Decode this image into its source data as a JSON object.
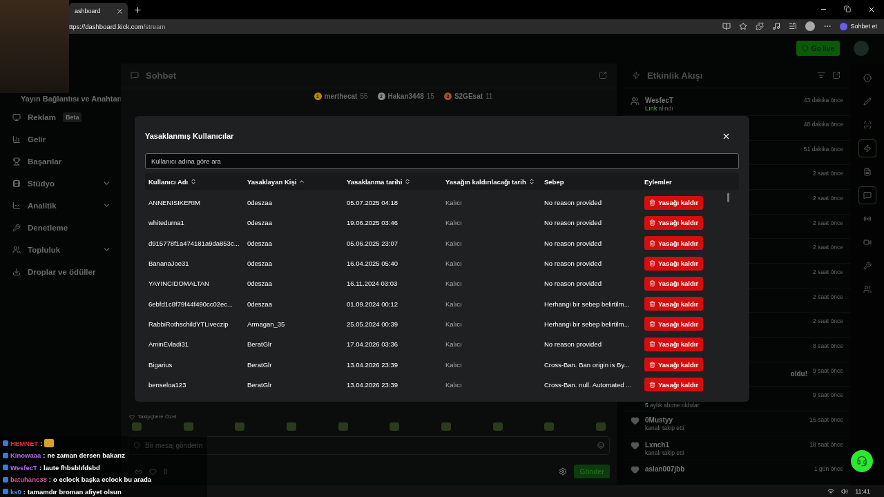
{
  "browser": {
    "tab_title": "ashboard",
    "url_host": "ttps://dashboard.kick.com",
    "url_path": "/stream",
    "copilot_label": "Sohbet et"
  },
  "header": {
    "go_live": "Go live"
  },
  "sidebar": {
    "items": [
      {
        "label": "Yayın Bağlantısı ve Anahtarı"
      },
      {
        "label": "Reklam",
        "badge": "Beta",
        "expandable": false
      },
      {
        "label": "Gelir",
        "expandable": false
      },
      {
        "label": "Başarılar",
        "expandable": false
      },
      {
        "label": "Stüdyo",
        "expandable": true
      },
      {
        "label": "Analitik",
        "expandable": true
      },
      {
        "label": "Denetleme",
        "expandable": false
      },
      {
        "label": "Topluluk",
        "expandable": true
      },
      {
        "label": "Droplar ve ödüller",
        "expandable": false
      }
    ]
  },
  "chat": {
    "title": "Sohbet",
    "leaderboard": [
      {
        "rank": "1",
        "name": "merthecat",
        "count": "55",
        "color": "#b8860b"
      },
      {
        "rank": "2",
        "name": "Hakan3448",
        "count": "15",
        "color": "#8a8a8a"
      },
      {
        "rank": "3",
        "name": "S2GEsat",
        "count": "11",
        "color": "#a0522d"
      }
    ],
    "followers_only_label": "Takipçilere Özel",
    "input_placeholder": "Bir mesaj gönderin",
    "points": "0",
    "send": "Gönder"
  },
  "activity": {
    "title": "Etkinlik Akışı",
    "items": [
      {
        "kind": "event",
        "user": "WesfecT",
        "highlight": "Link",
        "detail": "alındı",
        "time": "43 dakika önce"
      },
      {
        "kind": "plain",
        "time": "48 dakika önce"
      },
      {
        "kind": "plain",
        "time": "51 dakika önce"
      },
      {
        "kind": "plain",
        "time": "2 saat önce"
      },
      {
        "kind": "plain",
        "time": "2 saat önce"
      },
      {
        "kind": "plain",
        "time": "2 saat önce"
      },
      {
        "kind": "plain",
        "time": "2 saat önce"
      },
      {
        "kind": "plain",
        "time": "2 saat önce"
      },
      {
        "kind": "plain",
        "time": "2 saat önce"
      },
      {
        "kind": "plain",
        "time": "2 saat önce"
      },
      {
        "kind": "plain",
        "time": "8 saat önce"
      },
      {
        "kind": "plain",
        "user": "oldu!",
        "time": "9 saat önce"
      },
      {
        "kind": "plain",
        "highlight": "5",
        "detail": "aylık abone oldular",
        "time": "9 saat önce"
      },
      {
        "kind": "follow",
        "user": "0Mustyy",
        "detail": "kanalı takip etti",
        "time": "15 saat önce"
      },
      {
        "kind": "follow",
        "user": "Lxnch1",
        "detail": "kanalı takip etti",
        "time": "18 saat önce"
      },
      {
        "kind": "follow",
        "user": "aslan007jbb",
        "time": "1 gün önce"
      }
    ]
  },
  "rail": [
    {
      "selected": false
    },
    {
      "selected": false
    },
    {
      "selected": false
    },
    {
      "selected": true
    },
    {
      "selected": false
    },
    {
      "selected": true
    },
    {
      "selected": false
    },
    {
      "selected": false
    },
    {
      "selected": false
    },
    {
      "selected": false
    }
  ],
  "modal": {
    "title": "Yasaklanmış Kullanıcılar",
    "search_placeholder": "Kullanıcı adına göre ara",
    "columns": [
      {
        "label": "Kullanıcı Adı",
        "sortable": true,
        "sorted_ascending": false
      },
      {
        "label": "Yasaklayan Kişi",
        "sortable": true,
        "sorted_ascending": true
      },
      {
        "label": "Yasaklanma tarihi",
        "sortable": true,
        "sorted_ascending": false
      },
      {
        "label": "Yasağın kaldırılacağı tarih",
        "sortable": true,
        "sorted_ascending": false
      },
      {
        "label": "Sebep",
        "sortable": false
      },
      {
        "label": "Eylemler",
        "sortable": false
      }
    ],
    "rows": [
      {
        "user": "ANNENISIKERIM",
        "banned_by": "0deszaa",
        "banned_at": "05.07.2025 04:18",
        "expires": "Kalıcı",
        "reason": "No reason provided",
        "action": "Yasağı kaldır"
      },
      {
        "user": "whitedurna1",
        "banned_by": "0deszaa",
        "banned_at": "19.06.2025 03:46",
        "expires": "Kalıcı",
        "reason": "No reason provided",
        "action": "Yasağı kaldır"
      },
      {
        "user": "d915778f1a474181a9da853c...",
        "banned_by": "0deszaa",
        "banned_at": "05.06.2025 23:07",
        "expires": "Kalıcı",
        "reason": "No reason provided",
        "action": "Yasağı kaldır"
      },
      {
        "user": "BananaJoe31",
        "banned_by": "0deszaa",
        "banned_at": "16.04.2025 05:40",
        "expires": "Kalıcı",
        "reason": "No reason provided",
        "action": "Yasağı kaldır"
      },
      {
        "user": "YAYINCIDOMALTAN",
        "banned_by": "0deszaa",
        "banned_at": "16.11.2024 03:03",
        "expires": "Kalıcı",
        "reason": "No reason provided",
        "action": "Yasağı kaldır"
      },
      {
        "user": "6ebfd1c8f79f44f490cc02ec...",
        "banned_by": "0deszaa",
        "banned_at": "01.09.2024 00:12",
        "expires": "Kalıcı",
        "reason": "Herhangi bir sebep belirtilm...",
        "action": "Yasağı kaldır"
      },
      {
        "user": "RabbiRothschildYTLiveczip",
        "banned_by": "Armagan_35",
        "banned_at": "25.05.2024 00:39",
        "expires": "Kalıcı",
        "reason": "Herhangi bir sebep belirtilm...",
        "action": "Yasağı kaldır"
      },
      {
        "user": "AminEvladi31",
        "banned_by": "BeratGlr",
        "banned_at": "17.04.2026 03:36",
        "expires": "Kalıcı",
        "reason": "No reason provided",
        "action": "Yasağı kaldır"
      },
      {
        "user": "Bigarius",
        "banned_by": "BeratGlr",
        "banned_at": "13.04.2026 23:39",
        "expires": "Kalıcı",
        "reason": "Cross-Ban. Ban origin is By...",
        "action": "Yasağı kaldır"
      },
      {
        "user": "benseloa123",
        "banned_by": "BeratGlr",
        "banned_at": "13.04.2026 23:39",
        "expires": "Kalıcı",
        "reason": "Cross-Ban. null. Automated ...",
        "action": "Yasağı kaldır"
      }
    ]
  },
  "stream_chat": [
    {
      "user": "HEMNET",
      "color": "#e0283c",
      "separator": ":",
      "emote": true
    },
    {
      "user": "Kinowaaa",
      "color": "#b36cf0",
      "separator": ":",
      "message": "ne zaman dersen bakarız",
      "emote": false
    },
    {
      "user": "WesfecT",
      "color": "#b36cf0",
      "separator": ":",
      "message": "laute fhbsblıfdsbd",
      "emote": false
    },
    {
      "user": "batuhanc38",
      "color": "#d2589a",
      "separator": ":",
      "message": "o eclock başka eclock bu arada",
      "emote": false
    },
    {
      "user": "ks0",
      "color": "#4a8ee0",
      "separator": ":",
      "message": "tamamdır broman afiyet olsun",
      "emote": false
    }
  ],
  "taskbar": {
    "clock": "11:41"
  }
}
